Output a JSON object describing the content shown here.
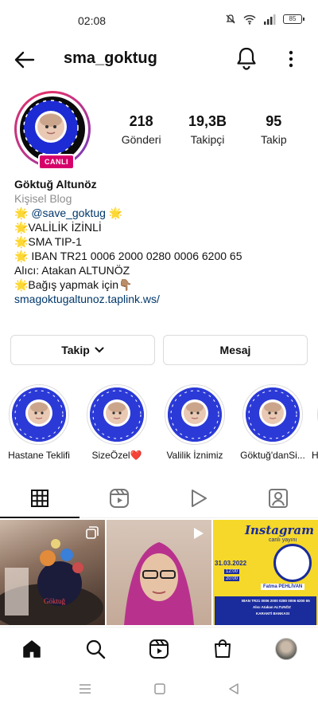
{
  "status": {
    "time": "02:08",
    "battery": "85"
  },
  "header": {
    "username": "sma_goktug"
  },
  "profile": {
    "live_label": "CANLI",
    "stats": [
      {
        "value": "218",
        "label": "Gönderi"
      },
      {
        "value": "19,3B",
        "label": "Takipçi"
      },
      {
        "value": "95",
        "label": "Takip"
      }
    ],
    "name": "Göktuğ Altunöz",
    "category": "Kişisel Blog",
    "bio_lines": [
      {
        "prefix": "🌟 ",
        "mention": "@save_goktug",
        "suffix": " 🌟"
      },
      {
        "text": "🌟VALİLİK İZİNLİ"
      },
      {
        "text": "🌟SMA TIP-1"
      },
      {
        "text": "🌟 IBAN TR21 0006 2000 0280 0006 6200 65"
      },
      {
        "text": "Alıcı: Atakan ALTUNÖZ"
      },
      {
        "text": "🌟Bağış yapmak için👇🏽"
      }
    ],
    "link": "smagoktugaltunoz.taplink.ws/"
  },
  "actions": {
    "follow_label": "Takip",
    "message_label": "Mesaj"
  },
  "highlights": [
    {
      "label": "Hastane Teklifi"
    },
    {
      "label": "SizeÖzel❤️"
    },
    {
      "label": "Valilik İznimiz"
    },
    {
      "label": "Göktuğ'danSi..."
    },
    {
      "label": "H"
    }
  ],
  "highlight_ring_text": "SMA TIP-1 HASTASI GÖKTUĞ",
  "posts": [
    {
      "kind": "carousel"
    },
    {
      "kind": "reel"
    },
    {
      "kind": "image",
      "title": "Instagram",
      "subtitle": "canlı yayını",
      "date": "31.03.2022",
      "time1": "12:00",
      "time2": "20:00",
      "guest": "Fatma PEHLİVAN",
      "footer1": "IBAN TR21 0006 2000 0280 0006 6200 65",
      "footer2": "Alıcı Atakan ALTUNÖZ",
      "footer3": "KARANTİ BANKASI"
    }
  ],
  "colors": {
    "accent_link": "#00376b",
    "live": "#d6006b",
    "highlight_blue": "#2b3ad6",
    "post_yellow": "#f5d82a"
  }
}
